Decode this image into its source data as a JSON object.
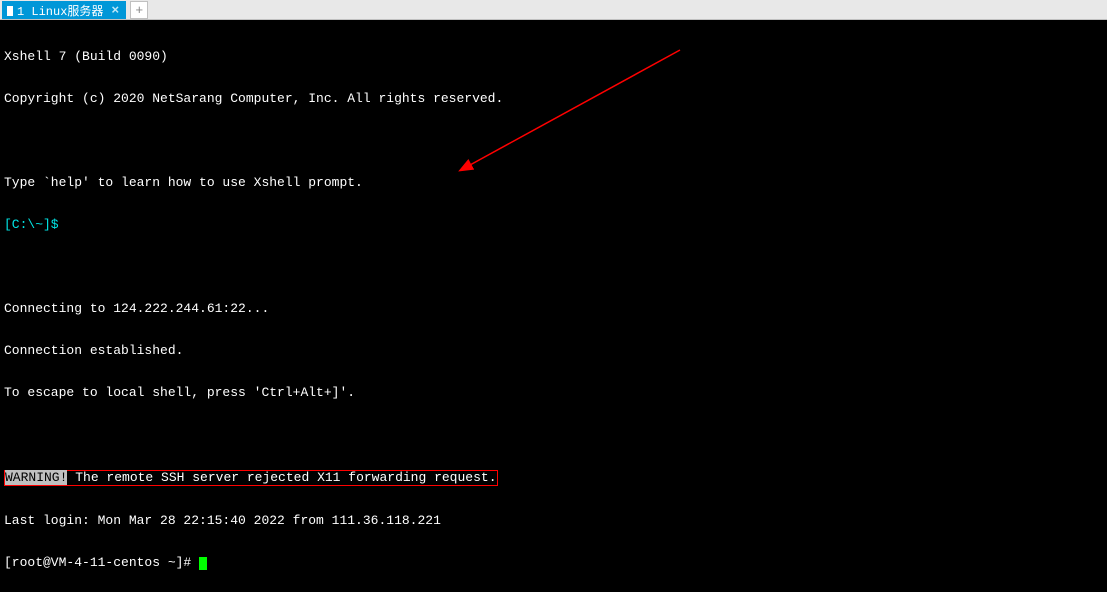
{
  "tab": {
    "title": "1 Linux服务器",
    "close": "×",
    "add": "+"
  },
  "terminal": {
    "line_app": "Xshell 7 (Build 0090)",
    "line_copyright": "Copyright (c) 2020 NetSarang Computer, Inc. All rights reserved.",
    "line_help": "Type `help' to learn how to use Xshell prompt.",
    "prompt_local": "[C:\\~]$ ",
    "line_connect": "Connecting to 124.222.244.61:22...",
    "line_established": "Connection established.",
    "line_escape": "To escape to local shell, press 'Ctrl+Alt+]'.",
    "warning_word": "WARNING!",
    "warning_rest": " The remote SSH server rejected X11 forwarding request.",
    "line_last_login": "Last login: Mon Mar 28 22:15:40 2022 from 111.36.118.221",
    "prompt_remote": "[root@VM-4-11-centos ~]# "
  }
}
